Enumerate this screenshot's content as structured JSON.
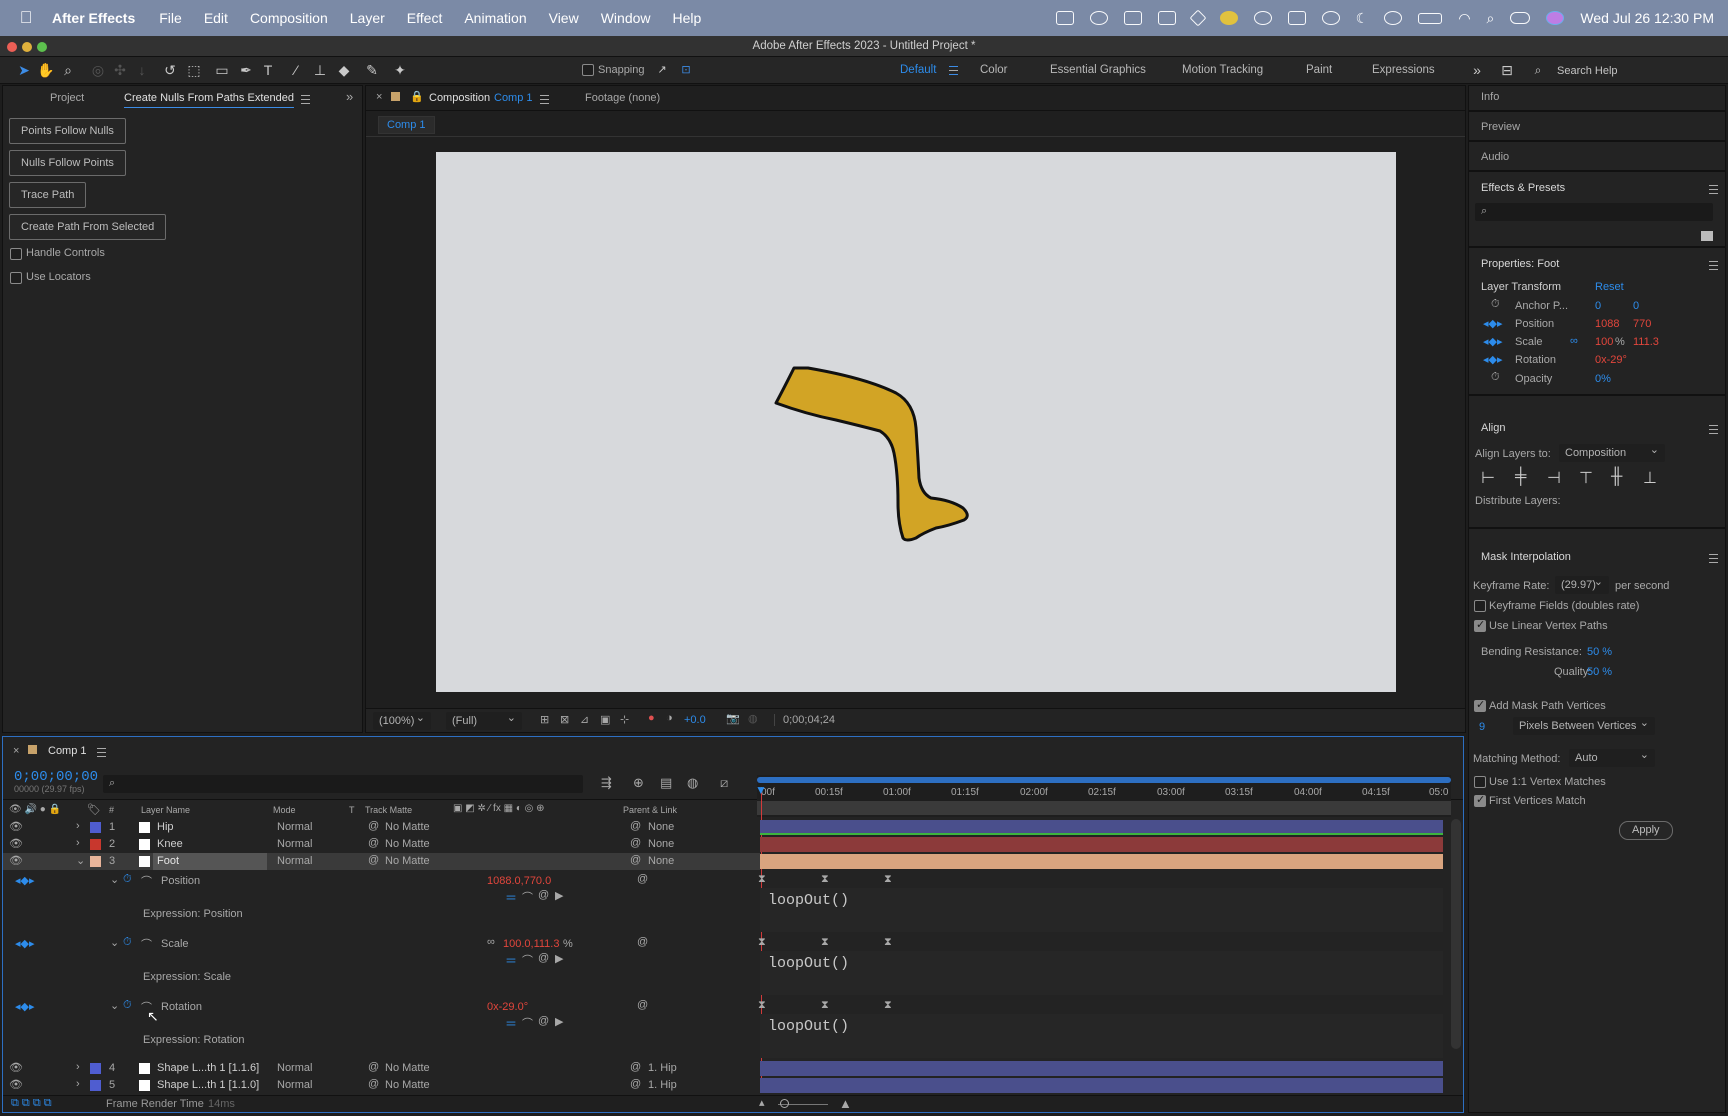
{
  "menubar": {
    "app": "After Effects",
    "items": [
      "File",
      "Edit",
      "Composition",
      "Layer",
      "Effect",
      "Animation",
      "View",
      "Window",
      "Help"
    ],
    "datetime": "Wed Jul 26  12:30 PM"
  },
  "window": {
    "title": "Adobe After Effects 2023 - Untitled Project *"
  },
  "toolbar": {
    "snapping": "Snapping",
    "workspaces": [
      "Default",
      "Color",
      "Essential Graphics",
      "Motion Tracking",
      "Paint",
      "Expressions"
    ],
    "search_placeholder": "Search Help"
  },
  "left_panel": {
    "tab_project": "Project",
    "tab_script": "Create Nulls From Paths Extended",
    "buttons": [
      "Points Follow Nulls",
      "Nulls Follow Points",
      "Trace Path",
      "Create Path From Selected"
    ],
    "checks": [
      "Handle Controls",
      "Use Locators"
    ]
  },
  "comp_panel": {
    "tab_prefix": "Composition",
    "tab_comp": "Comp 1",
    "footage": "Footage (none)",
    "breadcrumb": "Comp 1",
    "zoom": "(100%)",
    "resolution": "(Full)",
    "exposure": "+0.0",
    "timecode": "0;00;04;24"
  },
  "right_panel": {
    "info": "Info",
    "preview": "Preview",
    "audio": "Audio",
    "effects": "Effects & Presets",
    "properties": {
      "title": "Properties: Foot",
      "section": "Layer Transform",
      "reset": "Reset",
      "anchor": {
        "label": "Anchor P...",
        "x": "0",
        "y": "0"
      },
      "position": {
        "label": "Position",
        "x": "1088",
        "y": "770"
      },
      "scale": {
        "label": "Scale",
        "x": "100",
        "pct": "%",
        "y": "111.3"
      },
      "rotation": {
        "label": "Rotation",
        "value": "0x-29°"
      },
      "opacity": {
        "label": "Opacity",
        "value": "0%"
      }
    },
    "align": {
      "title": "Align",
      "align_to_label": "Align Layers to:",
      "align_to": "Composition",
      "distribute": "Distribute Layers:"
    },
    "mask": {
      "title": "Mask Interpolation",
      "keyframe_rate_label": "Keyframe Rate:",
      "keyframe_rate": "(29.97)",
      "per_second": "per second",
      "kf_fields": "Keyframe Fields (doubles rate)",
      "linear": "Use Linear Vertex Paths",
      "bending_label": "Bending Resistance:",
      "bending": "50 %",
      "quality_label": "Quality:",
      "quality": "50 %",
      "add_vertices": "Add Mask Path Vertices",
      "pixels": "9",
      "pixels_mode": "Pixels Between Vertices",
      "matching_label": "Matching Method:",
      "matching": "Auto",
      "use11": "Use 1:1 Vertex Matches",
      "first_match": "First Vertices Match",
      "apply": "Apply"
    }
  },
  "timeline": {
    "comp": "Comp 1",
    "timecode": "0;00;00;00",
    "fps": "00000 (29.97 fps)",
    "columns": {
      "num": "#",
      "layer_name": "Layer Name",
      "mode": "Mode",
      "t": "T",
      "track_matte": "Track Matte",
      "parent": "Parent & Link"
    },
    "ruler": [
      "00f",
      "00:15f",
      "01:00f",
      "01:15f",
      "02:00f",
      "02:15f",
      "03:00f",
      "03:15f",
      "04:00f",
      "04:15f",
      "05:0"
    ],
    "layers": [
      {
        "num": "1",
        "name": "Hip",
        "mode": "Normal",
        "matte": "No Matte",
        "parent": "None",
        "color": "#4f5dd0",
        "bar": "#4a4f8c"
      },
      {
        "num": "2",
        "name": "Knee",
        "mode": "Normal",
        "matte": "No Matte",
        "parent": "None",
        "color": "#c8372d",
        "bar": "#8c3a3a"
      },
      {
        "num": "3",
        "name": "Foot",
        "mode": "Normal",
        "matte": "No Matte",
        "parent": "None",
        "color": "#e8b49a",
        "bar": "#d9a47f"
      },
      {
        "num": "4",
        "name": "Shape L...th 1 [1.1.6]",
        "mode": "Normal",
        "matte": "No Matte",
        "parent": "1. Hip",
        "color": "#4f5dd0",
        "bar": "#4a4f8c"
      },
      {
        "num": "5",
        "name": "Shape L...th 1 [1.1.0]",
        "mode": "Normal",
        "matte": "No Matte",
        "parent": "1. Hip",
        "color": "#4f5dd0",
        "bar": "#4a4f8c"
      }
    ],
    "props": [
      {
        "name": "Position",
        "value": "1088.0,770.0",
        "expr_label": "Expression: Position",
        "expr": "loopOut()"
      },
      {
        "name": "Scale",
        "value": "100.0,111.3",
        "pct": "%",
        "expr_label": "Expression: Scale",
        "expr": "loopOut()"
      },
      {
        "name": "Rotation",
        "value": "0x-29.0°",
        "expr_label": "Expression: Rotation",
        "expr": "loopOut()"
      }
    ],
    "footer": "Frame Render Time",
    "footer_ms": "14ms"
  }
}
